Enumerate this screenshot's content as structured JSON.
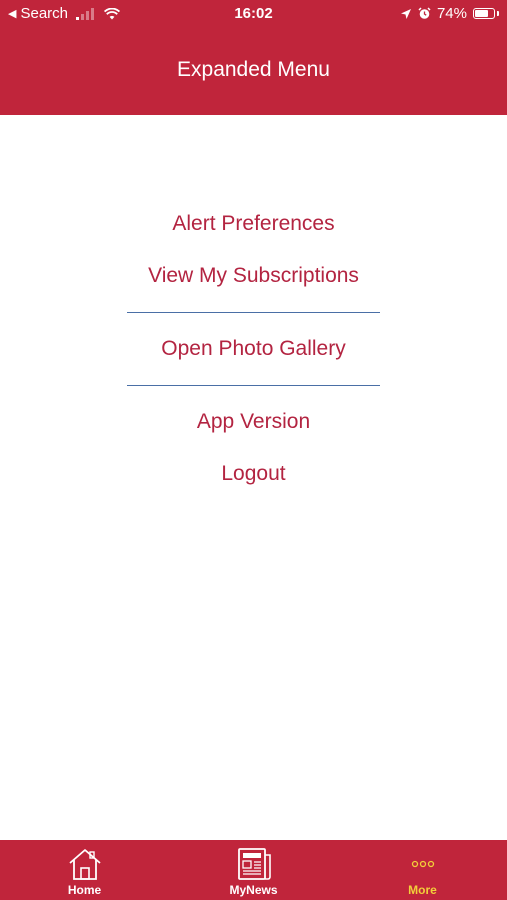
{
  "status_bar": {
    "back_label": "Search",
    "time": "16:02",
    "battery": "74%",
    "battery_level": 0.74
  },
  "header": {
    "title": "Expanded Menu"
  },
  "menu": {
    "items": [
      {
        "label": "Alert Preferences"
      },
      {
        "label": "View My Subscriptions"
      },
      {
        "label": "Open Photo Gallery"
      },
      {
        "label": "App Version"
      },
      {
        "label": "Logout"
      }
    ]
  },
  "tab_bar": {
    "tabs": [
      {
        "label": "Home",
        "icon": "home-icon"
      },
      {
        "label": "MyNews",
        "icon": "newspaper-icon"
      },
      {
        "label": "More",
        "icon": "more-icon",
        "active": true
      }
    ]
  },
  "colors": {
    "brand": "#c0253b",
    "menu_text": "#b32441",
    "divider": "#4a6fa6",
    "active_tab": "#f2cf3a"
  }
}
